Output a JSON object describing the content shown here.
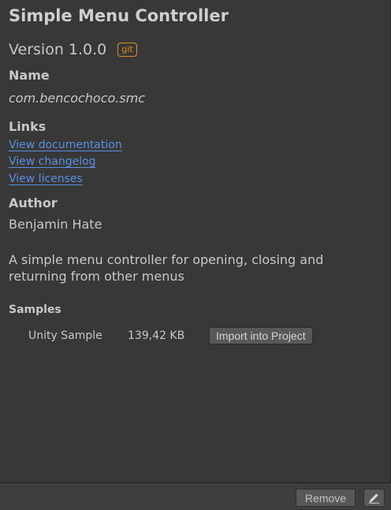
{
  "package": {
    "title": "Simple Menu Controller",
    "version": "Version 1.0.0",
    "source_badge": "git"
  },
  "name_section": {
    "label": "Name",
    "value": "com.bencochoco.smc"
  },
  "links_section": {
    "label": "Links",
    "items": [
      "View documentation",
      "View changelog",
      "View licenses"
    ]
  },
  "author_section": {
    "label": "Author",
    "value": "Benjamin Hate"
  },
  "description": "A simple menu controller for opening, closing and returning from other menus",
  "samples_section": {
    "label": "Samples",
    "items": [
      {
        "name": "Unity Sample",
        "size": "139,42 KB",
        "action": "Import into Project"
      }
    ]
  },
  "footer": {
    "remove_label": "Remove",
    "edit_icon": "pencil-icon"
  },
  "colors": {
    "background": "#383838",
    "link": "#5a8ee0",
    "git_badge": "#e38a28"
  }
}
